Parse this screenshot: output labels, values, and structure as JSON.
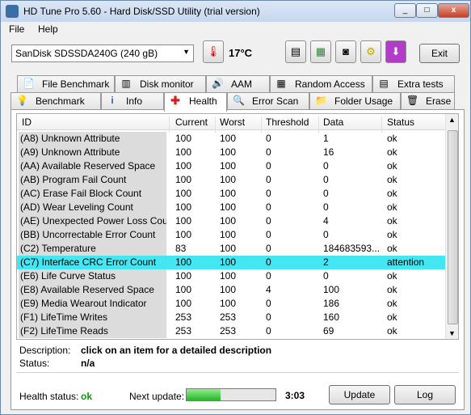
{
  "window": {
    "title": "HD Tune Pro 5.60 - Hard Disk/SSD Utility (trial version)",
    "min": "_",
    "max": "□",
    "close": "x"
  },
  "menu": [
    "File",
    "Help"
  ],
  "toolbar": {
    "drive": "SanDisk SDSSDA240G (240 gB)",
    "temperature": "17°C",
    "exit_label": "Exit"
  },
  "tabs_top": [
    "File Benchmark",
    "Disk monitor",
    "AAM",
    "Random Access",
    "Extra tests"
  ],
  "tabs_bottom": [
    "Benchmark",
    "Info",
    "Health",
    "Error Scan",
    "Folder Usage",
    "Erase"
  ],
  "active_tab": "Health",
  "table": {
    "columns": [
      "ID",
      "Current",
      "Worst",
      "Threshold",
      "Data",
      "Status"
    ],
    "rows": [
      [
        "(A8) Unknown Attribute",
        "100",
        "100",
        "0",
        "1",
        "ok"
      ],
      [
        "(A9) Unknown Attribute",
        "100",
        "100",
        "0",
        "16",
        "ok"
      ],
      [
        "(AA) Available Reserved Space",
        "100",
        "100",
        "0",
        "0",
        "ok"
      ],
      [
        "(AB) Program Fail Count",
        "100",
        "100",
        "0",
        "0",
        "ok"
      ],
      [
        "(AC) Erase Fail Block Count",
        "100",
        "100",
        "0",
        "0",
        "ok"
      ],
      [
        "(AD) Wear Leveling Count",
        "100",
        "100",
        "0",
        "0",
        "ok"
      ],
      [
        "(AE) Unexpected Power Loss Count",
        "100",
        "100",
        "0",
        "4",
        "ok"
      ],
      [
        "(BB) Uncorrectable Error Count",
        "100",
        "100",
        "0",
        "0",
        "ok"
      ],
      [
        "(C2) Temperature",
        "83",
        "100",
        "0",
        "184683593...",
        "ok"
      ],
      [
        "(C7) Interface CRC Error Count",
        "100",
        "100",
        "0",
        "2",
        "attention"
      ],
      [
        "(E6) Life Curve Status",
        "100",
        "100",
        "0",
        "0",
        "ok"
      ],
      [
        "(E8) Available Reserved Space",
        "100",
        "100",
        "4",
        "100",
        "ok"
      ],
      [
        "(E9) Media Wearout Indicator",
        "100",
        "100",
        "0",
        "186",
        "ok"
      ],
      [
        "(F1) LifeTime Writes",
        "253",
        "253",
        "0",
        "160",
        "ok"
      ],
      [
        "(F2) LifeTime Reads",
        "253",
        "253",
        "0",
        "69",
        "ok"
      ]
    ],
    "selected_row": 9
  },
  "details": {
    "description_label": "Description:",
    "description_value": "click on an item for a detailed description",
    "status_label": "Status:",
    "status_value": "n/a"
  },
  "footer": {
    "health_label": "Health status:",
    "health_value": "ok",
    "next_update_label": "Next update:",
    "progress": 0.38,
    "time": "3:03",
    "update_label": "Update",
    "log_label": "Log"
  },
  "colors": {
    "selected_row": "#44e6f2",
    "health_ok": "#0a9b0a",
    "progress": "#26b426"
  },
  "icons": {
    "top": [
      "file-benchmark-icon",
      "disk-monitor-icon",
      "aam-speaker-icon",
      "random-access-icon",
      "extra-tests-icon"
    ],
    "bottom": [
      "benchmark-lightbulb-icon",
      "info-icon",
      "health-cross-icon",
      "error-scan-magnifier-icon",
      "folder-icon",
      "erase-trash-icon"
    ]
  }
}
